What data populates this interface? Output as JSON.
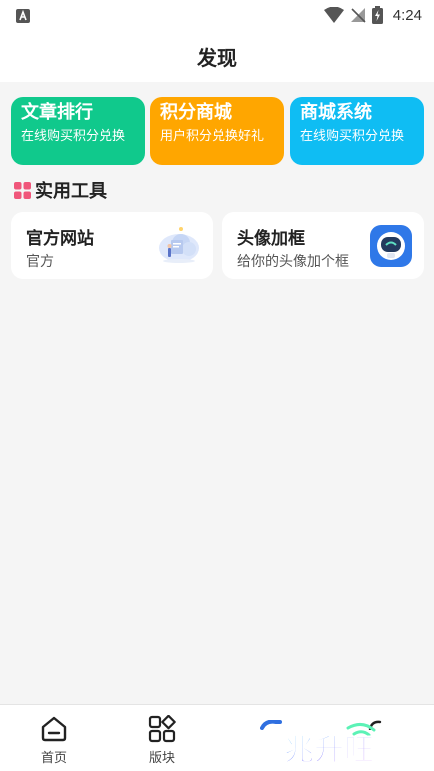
{
  "status": {
    "time": "4:24"
  },
  "header": {
    "title": "发现"
  },
  "cards": [
    {
      "title": "文章排行",
      "subtitle": "在线购买积分兑换",
      "color": "#10c98c"
    },
    {
      "title": "积分商城",
      "subtitle": "用户积分兑换好礼",
      "color": "#ffa600"
    },
    {
      "title": "商城系统",
      "subtitle": "在线购买积分兑换",
      "color": "#0fbdf3"
    }
  ],
  "section": {
    "title": "实用工具",
    "accent": "#f0567a"
  },
  "tools": [
    {
      "title": "官方网站",
      "subtitle": "官方",
      "icon": "website-illustration-icon"
    },
    {
      "title": "头像加框",
      "subtitle": "给你的头像加个框",
      "icon": "robot-avatar-icon"
    }
  ],
  "tabbar": {
    "items": [
      {
        "label": "首页",
        "icon": "home-icon"
      },
      {
        "label": "版块",
        "icon": "grid-icon"
      }
    ]
  },
  "watermark": {
    "text": "兆升旺"
  }
}
